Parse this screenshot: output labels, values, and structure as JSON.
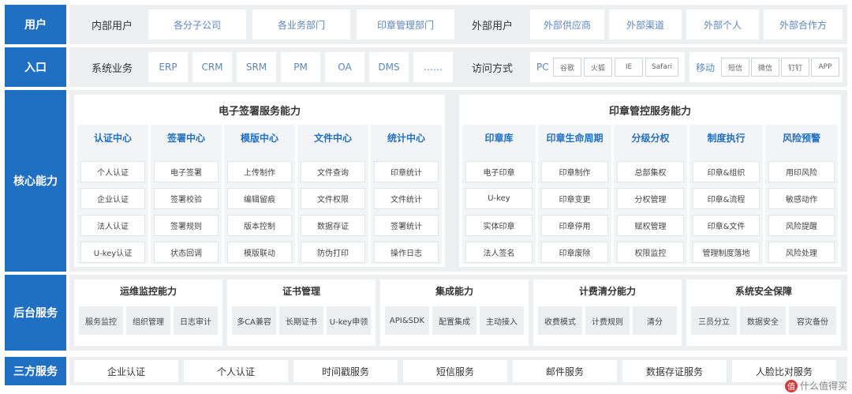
{
  "rows": {
    "users": {
      "label": "用户",
      "internal_title": "内部用户",
      "internal": [
        "各分子公司",
        "各业务部门",
        "印章管理部门"
      ],
      "external_title": "外部用户",
      "external": [
        "外部供应商",
        "外部渠道",
        "外部个人",
        "外部合作方"
      ]
    },
    "entry": {
      "label": "入口",
      "systems_title": "系统业务",
      "systems": [
        "ERP",
        "CRM",
        "SRM",
        "PM",
        "OA",
        "DMS",
        "……"
      ],
      "access_title": "访问方式",
      "pc_label": "PC",
      "pc_items": [
        "谷歌",
        "火狐",
        "IE",
        "Safari"
      ],
      "mobile_label": "移动",
      "mobile_items": [
        "短信",
        "微信",
        "钉钉",
        "APP"
      ]
    },
    "core": {
      "label": "核心能力",
      "esign": {
        "title": "电子签署服务能力",
        "columns": [
          {
            "title": "认证中心",
            "items": [
              "个人认证",
              "企业认证",
              "法人认证",
              "U-key认证"
            ]
          },
          {
            "title": "签署中心",
            "items": [
              "电子签署",
              "签署校验",
              "签署规则",
              "状态回调"
            ]
          },
          {
            "title": "模版中心",
            "items": [
              "上传制作",
              "编辑留痕",
              "版本控制",
              "模版联动"
            ]
          },
          {
            "title": "文件中心",
            "items": [
              "文件查询",
              "文件权限",
              "数据存证",
              "防伪打印"
            ]
          },
          {
            "title": "统计中心",
            "items": [
              "印章统计",
              "文件统计",
              "签署统计",
              "操作日志"
            ]
          }
        ]
      },
      "seal": {
        "title": "印章管控服务能力",
        "columns": [
          {
            "title": "印章库",
            "items": [
              "电子印章",
              "U-key",
              "实体印章",
              "法人签名"
            ]
          },
          {
            "title": "印章生命周期",
            "items": [
              "印章制作",
              "印章变更",
              "印章停用",
              "印章废除"
            ]
          },
          {
            "title": "分级分权",
            "items": [
              "总部集权",
              "分权管理",
              "赋权管理",
              "权限监控"
            ]
          },
          {
            "title": "制度执行",
            "items": [
              "印章&组织",
              "印章&流程",
              "印章&文件",
              "管理制度落地"
            ]
          },
          {
            "title": "风险预警",
            "items": [
              "用印风险",
              "敏感动作",
              "风险提醒",
              "风险处理"
            ]
          }
        ]
      }
    },
    "backend": {
      "label": "后台服务",
      "sections": [
        {
          "title": "运维监控能力",
          "items": [
            "服务监控",
            "组织管理",
            "日志审计"
          ]
        },
        {
          "title": "证书管理",
          "items": [
            "多CA兼容",
            "长期证书",
            "U-key申领"
          ]
        },
        {
          "title": "集成能力",
          "items": [
            "API&SDK",
            "配置集成",
            "主动接入"
          ]
        },
        {
          "title": "计费清分能力",
          "items": [
            "收费模式",
            "计费规则",
            "清分"
          ]
        },
        {
          "title": "系统安全保障",
          "items": [
            "三员分立",
            "数据安全",
            "容灾备份"
          ]
        }
      ]
    },
    "third": {
      "label": "三方服务",
      "items": [
        "企业认证",
        "个人认证",
        "时间戳服务",
        "短信服务",
        "邮件服务",
        "数据存证服务",
        "人脸比对服务"
      ]
    }
  },
  "watermark": {
    "text": "什么值得买",
    "icon": "值"
  },
  "colors": {
    "accent": "#1f6fc3",
    "panel_bg": "#eeeff1",
    "link_text": "#5a86c0"
  }
}
